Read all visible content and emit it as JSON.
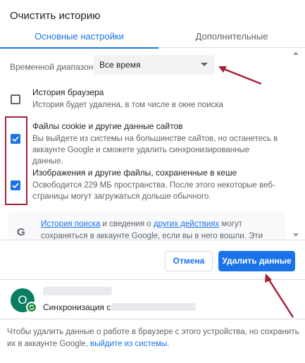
{
  "dialog": {
    "title": "Очистить историю"
  },
  "tabs": [
    {
      "label": "Основные настройки",
      "active": true
    },
    {
      "label": "Дополнительные",
      "active": false
    }
  ],
  "time_range": {
    "label": "Временной диапазон",
    "value": "Все время"
  },
  "options": [
    {
      "title": "История браузера",
      "desc": "История будет удалена, в том числе в окне поиска",
      "checked": false
    },
    {
      "title": "Файлы cookie и другие данные сайтов",
      "desc": "Вы выйдете из системы на большинстве сайтов, но останетесь в аккаунте Google и сможете удалить синхронизированные данные.",
      "checked": true
    },
    {
      "title": "Изображения и другие файлы, сохраненные в кеше",
      "desc": "Освободится 229 МБ пространства. После этого некоторые веб-страницы могут загружаться дольше обычного.",
      "checked": true
    }
  ],
  "info": {
    "icon_letter": "G",
    "link1": "История поиска",
    "text1": " и сведения о ",
    "link2": "других действиях",
    "text2": " могут сохраняться в аккаунте Google, если вы в него вошли. Эти данные можно удалить"
  },
  "buttons": {
    "cancel": "Отмена",
    "delete": "Удалить данные"
  },
  "account": {
    "avatar_letter": "O",
    "sync_text": "Синхронизация с"
  },
  "footer": {
    "text": "Чтобы удалить данные о работе в браузере с этого устройства, но сохранить их в аккаунте Google, ",
    "link": "выйдите из системы",
    "end": "."
  },
  "colors": {
    "accent": "#1a73e8",
    "annotation": "#a6213a"
  }
}
